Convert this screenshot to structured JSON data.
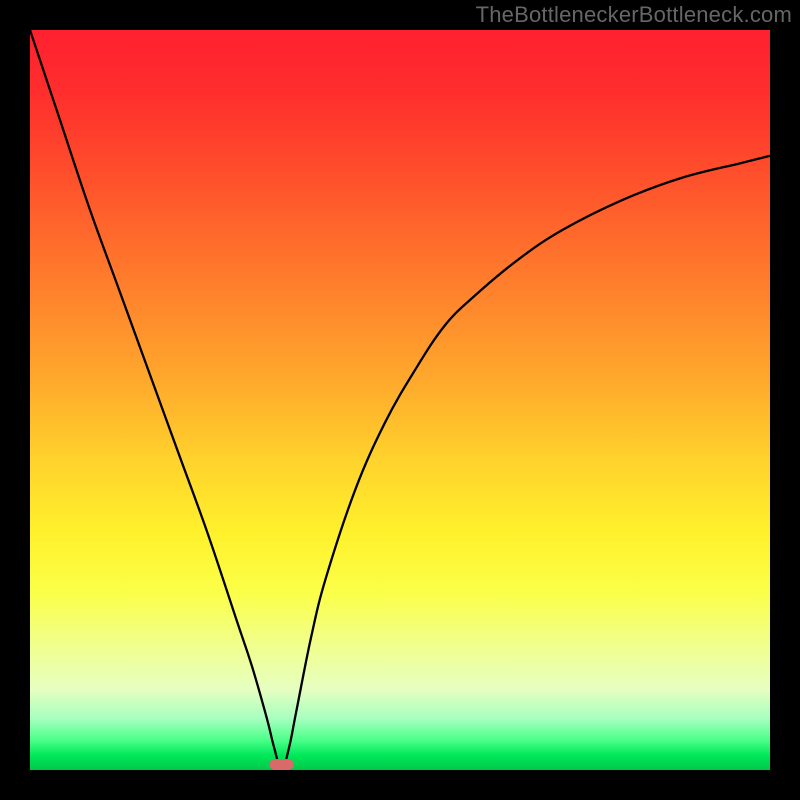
{
  "watermark": "TheBottleneckerBottleneck.com",
  "chart_data": {
    "type": "line",
    "title": "",
    "xlabel": "",
    "ylabel": "",
    "xlim": [
      0,
      100
    ],
    "ylim": [
      0,
      100
    ],
    "grid": false,
    "legend": false,
    "annotations": [],
    "marker": {
      "x": 34,
      "y": 0,
      "color": "#d86a6a",
      "shape": "rounded-rect"
    },
    "series": [
      {
        "name": "curve",
        "color": "#000000",
        "x": [
          0,
          4,
          8,
          12,
          16,
          20,
          24,
          28,
          30,
          32,
          33,
          34,
          35,
          36,
          38,
          40,
          44,
          48,
          52,
          56,
          60,
          66,
          72,
          80,
          88,
          96,
          100
        ],
        "y": [
          100,
          88,
          76,
          65,
          54,
          43,
          32,
          20,
          14,
          7,
          3,
          0,
          3,
          8,
          18,
          26,
          38,
          47,
          54,
          60,
          64,
          69,
          73,
          77,
          80,
          82,
          83
        ]
      }
    ]
  }
}
